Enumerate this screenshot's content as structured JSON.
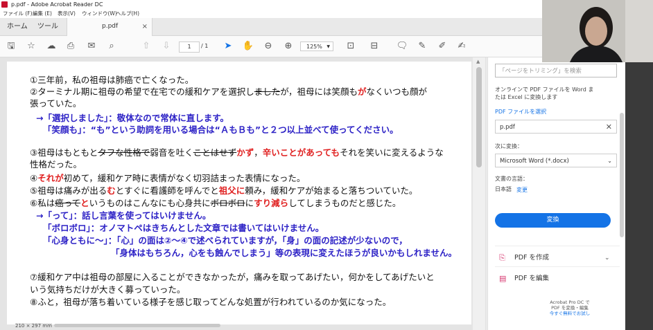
{
  "window": {
    "title": "p.pdf - Adobe Acrobat Reader DC"
  },
  "menu": [
    "ファイル (F)",
    "編集 (E)",
    "表示(V)",
    "ウィンドウ(W)",
    "ヘルプ(H)"
  ],
  "tabs": {
    "home": "ホーム",
    "tools": "ツール",
    "doc": "p.pdf",
    "close": "×"
  },
  "toolbar": {
    "page_current": "1",
    "page_total": "/ 1",
    "zoom": "125%"
  },
  "doc": {
    "page_size": "210 × 297 mm",
    "l1": "①三年前，私の祖母は肺癌で亡くなった。",
    "l2a": "②ターミナル期に祖母の希望で在宅での緩和ケアを選択し",
    "l2b": "ました",
    "l2c": "が",
    "l2d": "，祖母には笑顔も",
    "l2e": "が",
    "l2f": "なくいつも顔が",
    "l3": "張っていた。",
    "c1": "→「選択しました」：敬体なので常体に直します。",
    "c2": "「笑顔も」：“も”という助詞を用いる場合は“ＡもＢも”と２つ以上並べて使ってください。",
    "l4a": "③祖母はもともと",
    "l4b": "タフな性格で",
    "l4c": "弱音を吐く",
    "l4d": "ことはせず",
    "l4e": "かず",
    "l4f": "，",
    "l4g": "辛いことがあっても",
    "l4h": "それを笑いに変えるような",
    "l5": "性格だった。",
    "l6a": "④",
    "l6b": "それが",
    "l6c": "初めて，緩和ケア時に表情がなく切羽詰まった表情になった。",
    "l7a": "⑤祖母は痛みが出る",
    "l7b": "む",
    "l7c": "とすぐに看護師を呼んでと",
    "l7d": "祖父に",
    "l7e": "頼み，緩和ケアが始まると落ちついていた。",
    "l8a": "⑥私は",
    "l8b": "癌って",
    "l8c": "と",
    "l8d": "いうものはこんなにも心身共に",
    "l8e": "ボロボロ",
    "l8f": "に",
    "l8g": "すり減ら",
    "l8h": "してしまうものだと感じた。",
    "c3": "→「って」：話し言葉を使ってはいけません。",
    "c4": "「ボロボロ」：オノマトペはきちんとした文章では書いてはいけません。",
    "c5": "「心身ともに～」：「心」の面は②～④で述べられていますが，「身」の面の記述が少ないので，",
    "c6": "「身体はもちろん，心をも蝕んでしまう」等の表現に変えたほうが良いかもしれません。",
    "l9": "⑦緩和ケア中は祖母の部屋に入ることができなかったが，痛みを取ってあげたい，何かをしてあげたいと",
    "l10": "いう気持ちだけが大きく募っていった。",
    "l11": "⑧ふと，祖母が落ち着いている様子を感じ取ってどんな処置が行われているのか気になった。"
  },
  "panel": {
    "search_placeholder": "「ページをトリミング」を検索",
    "online_desc1": "オンラインで PDF ファイルを Word ま",
    "online_desc2": "たは Excel に変換します",
    "select_file": "PDF ファイルを選択",
    "file": "p.pdf",
    "convert_to": "次に変換：",
    "format": "Microsoft Word (*.docx)",
    "doc_lang": "文書の言語：",
    "lang": "日本語",
    "change": "変更",
    "convert_btn": "変換",
    "create_pdf": "PDF を作成",
    "edit_pdf": "PDF を編集",
    "pro1": "Acrobat Pro DC で",
    "pro2": "PDF を変換・編集",
    "pro3": "今すぐ無料でお試し"
  },
  "colors": {
    "accent": "#1473e6",
    "comment": "#2d22c6",
    "correction": "#e02020"
  }
}
